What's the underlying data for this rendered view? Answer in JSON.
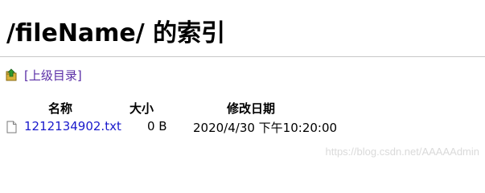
{
  "page": {
    "title": "/fileName/ 的索引"
  },
  "navigation": {
    "parent_link_label": "[上级目录]",
    "parent_icon": "folder-up-icon"
  },
  "listing": {
    "headers": {
      "name": "名称",
      "size": "大小",
      "modified": "修改日期"
    },
    "files": [
      {
        "name": "1212134902.txt",
        "size": "0 B",
        "modified": "2020/4/30 下午10:20:00",
        "icon": "file-icon"
      }
    ]
  },
  "watermark": {
    "text": "https://blog.csdn.net/AAAAAdmin"
  },
  "colors": {
    "parent_link": "#5a2ea6",
    "file_link": "#1a1acc",
    "divider": "#c8c8c8"
  }
}
